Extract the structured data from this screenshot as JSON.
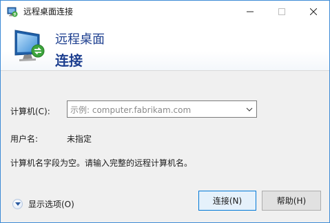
{
  "window": {
    "title": "远程桌面连接"
  },
  "banner": {
    "line1": "远程桌面",
    "line2": "连接"
  },
  "form": {
    "computer_label": "计算机(C):",
    "computer_placeholder": "示例: computer.fabrikam.com",
    "username_label": "用户名:",
    "username_value": "未指定",
    "message": "计算机名字段为空。请输入完整的远程计算机名。"
  },
  "footer": {
    "options_label": "显示选项(O)"
  },
  "buttons": {
    "connect": "连接(N)",
    "help": "帮助(H)"
  }
}
